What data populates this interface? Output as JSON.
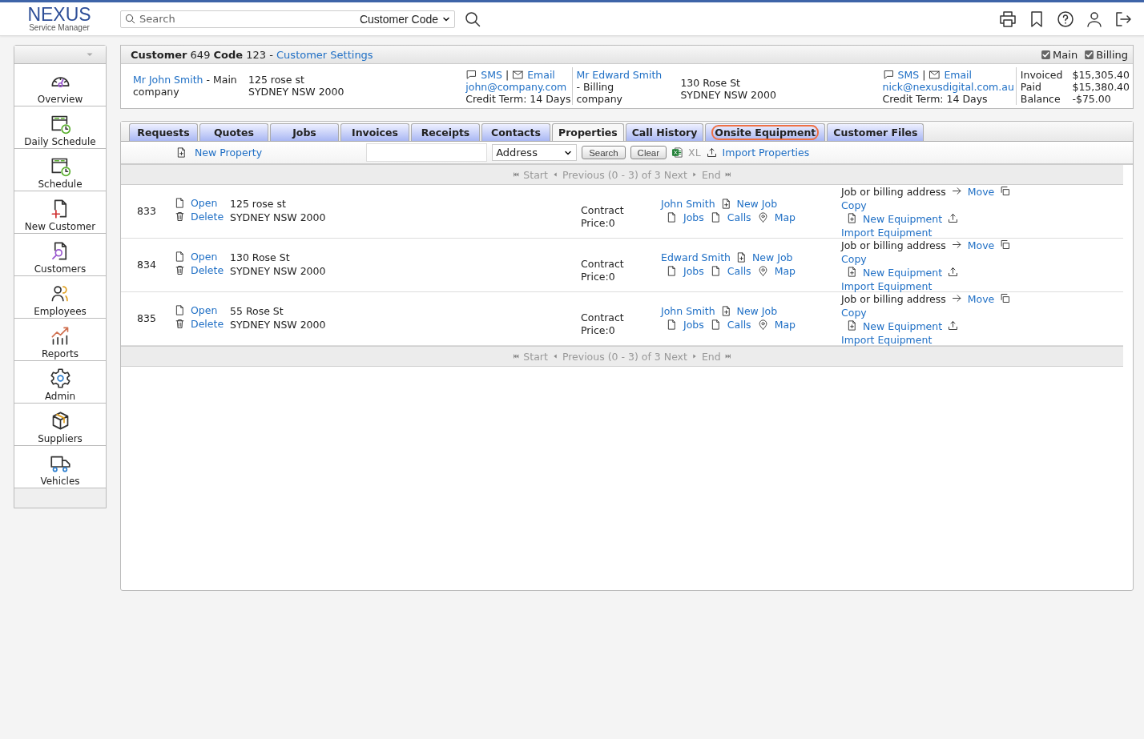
{
  "brand": {
    "name": "NEXUS",
    "tagline": "Service Manager"
  },
  "search": {
    "placeholder": "Search",
    "scope": "Customer Code"
  },
  "sidebar": [
    {
      "label": "Overview"
    },
    {
      "label": "Daily Schedule"
    },
    {
      "label": "Schedule"
    },
    {
      "label": "New Customer"
    },
    {
      "label": "Customers"
    },
    {
      "label": "Employees"
    },
    {
      "label": "Reports"
    },
    {
      "label": "Admin"
    },
    {
      "label": "Suppliers"
    },
    {
      "label": "Vehicles"
    }
  ],
  "customer": {
    "title": "**Customer** 649 **Code** 123 - ",
    "settings_link": "Customer Settings",
    "filters": [
      {
        "label": "Main",
        "checked": true
      },
      {
        "label": "Billing",
        "checked": true
      }
    ],
    "contacts": [
      {
        "name": "Mr John Smith",
        "role": "- Main",
        "company": "company",
        "address": [
          "125 rose st",
          "SYDNEY NSW 2000"
        ],
        "sms": "SMS",
        "separator": "|",
        "email_label": "Email",
        "email": "john@company.com",
        "credit_term": "Credit Term: 14 Days"
      },
      {
        "name": "Mr Edward Smith",
        "role": "- Billing",
        "company": "company",
        "address": [
          "130 Rose St",
          "SYDNEY NSW 2000"
        ],
        "sms": "SMS",
        "separator": "|",
        "email_label": "Email",
        "email": "nick@nexusdigital.com.au",
        "credit_term": "Credit Term: 14 Days"
      }
    ],
    "totals": [
      {
        "label": "Invoiced",
        "value": "$15,305.40"
      },
      {
        "label": "Paid",
        "value": "$15,380.40"
      },
      {
        "label": "Balance",
        "value": "-$75.00"
      }
    ]
  },
  "tabs": [
    {
      "label": "Requests",
      "selected": false,
      "circled": false
    },
    {
      "label": "Quotes",
      "selected": false,
      "circled": false
    },
    {
      "label": "Jobs",
      "selected": false,
      "circled": false
    },
    {
      "label": "Invoices",
      "selected": false,
      "circled": false
    },
    {
      "label": "Receipts",
      "selected": false,
      "circled": false
    },
    {
      "label": "Contacts",
      "selected": false,
      "circled": false
    },
    {
      "label": "Properties",
      "selected": true,
      "circled": false
    },
    {
      "label": "Call History",
      "selected": false,
      "circled": false
    },
    {
      "label": "Onsite Equipment",
      "selected": false,
      "circled": true
    },
    {
      "label": "Customer Files",
      "selected": false,
      "circled": false
    }
  ],
  "toolbar": {
    "new_property": "New Property",
    "filter_field": "Address",
    "search_button": "Search",
    "clear_button": "Clear",
    "export": {
      "label": "XL",
      "disabled": true
    },
    "import": "Import Properties"
  },
  "pager_top": {
    "start": "Start",
    "previous": "Previous",
    "range": "(0 - 3) of 3",
    "next": "Next",
    "end": "End"
  },
  "properties": [
    {
      "id": "833",
      "open": "Open",
      "delete": "Delete",
      "address": [
        "125 rose st",
        "SYDNEY NSW 2000"
      ],
      "contract": "Contract Price:0",
      "contact": "John Smith",
      "new_job": "New Job",
      "jobs": "Jobs",
      "calls": "Calls",
      "map": "Map",
      "address_type": "Job or billing address",
      "move": "Move",
      "copy": "Copy",
      "new_equipment": "New Equipment",
      "import": "Import Equipment"
    },
    {
      "id": "834",
      "open": "Open",
      "delete": "Delete",
      "address": [
        "130 Rose St",
        "SYDNEY NSW 2000"
      ],
      "contract": "Contract Price:0",
      "contact": "Edward Smith",
      "new_job": "New Job",
      "jobs": "Jobs",
      "calls": "Calls",
      "map": "Map",
      "address_type": "Job or billing address",
      "move": "Move",
      "copy": "Copy",
      "new_equipment": "New Equipment",
      "import": "Import Equipment"
    },
    {
      "id": "835",
      "open": "Open",
      "delete": "Delete",
      "address": [
        "55 Rose St",
        "SYDNEY NSW 2000"
      ],
      "contract": "Contract Price:0",
      "contact": "John Smith",
      "new_job": "New Job",
      "jobs": "Jobs",
      "calls": "Calls",
      "map": "Map",
      "address_type": "Job or billing address",
      "move": "Move",
      "copy": "Copy",
      "new_equipment": "New Equipment",
      "import": "Import Equipment"
    }
  ],
  "pager_bottom": {
    "start": "Start",
    "previous": "Previous",
    "range": "(0 - 3) of 3",
    "next": "Next",
    "end": "End"
  }
}
